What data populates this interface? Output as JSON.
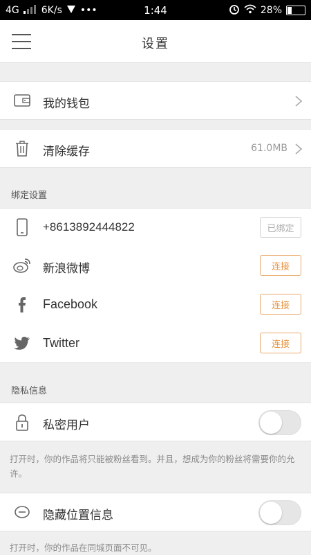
{
  "status_bar": {
    "network": "4G",
    "speed": "6K/s",
    "more": "•••",
    "time": "1:44",
    "battery": "28%",
    "battery_level": 0.28
  },
  "header": {
    "title": "设置"
  },
  "wallet": {
    "label": "我的钱包"
  },
  "cache": {
    "label": "清除缓存",
    "value": "61.0MB"
  },
  "binding": {
    "section_title": "绑定设置",
    "phone": {
      "label": "+8613892444822",
      "button": "已绑定"
    },
    "weibo": {
      "label": "新浪微博",
      "button": "连接"
    },
    "facebook": {
      "label": "Facebook",
      "button": "连接"
    },
    "twitter": {
      "label": "Twitter",
      "button": "连接"
    }
  },
  "privacy": {
    "section_title": "隐私信息",
    "private_user": {
      "label": "私密用户",
      "enabled": false,
      "description": "打开时，你的作品将只能被粉丝看到。并且，想成为你的粉丝将需要你的允许。"
    },
    "hide_location": {
      "label": "隐藏位置信息",
      "enabled": false,
      "description": "打开时，你的作品在同城页面不可见。"
    }
  },
  "colors": {
    "accent": "#e8933e",
    "background": "#efefef"
  }
}
